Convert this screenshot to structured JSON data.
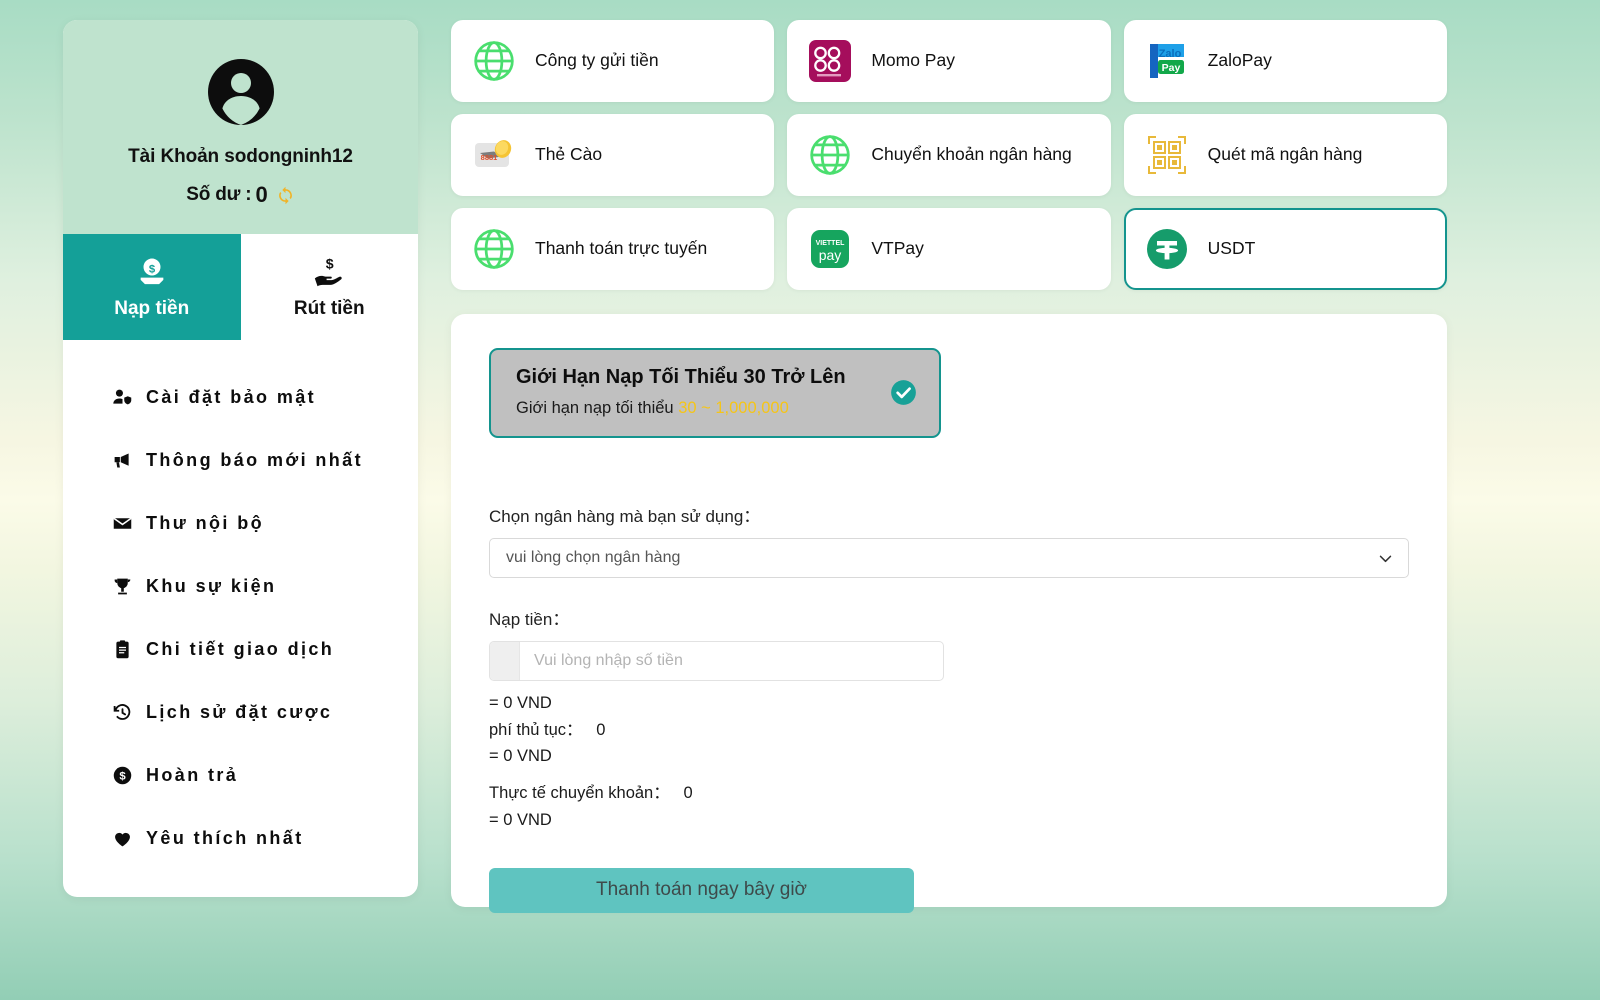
{
  "profile": {
    "avatar_icon": "user-circle-icon",
    "name": "Tài Khoản sodongninh12",
    "balance_label": "Số dư :",
    "balance_value": "0",
    "refresh_icon": "refresh-icon"
  },
  "tabs": [
    {
      "label": "Nạp tiền",
      "icon": "deposit-coin-icon",
      "active": true
    },
    {
      "label": "Rút tiền",
      "icon": "withdraw-hand-icon",
      "active": false
    }
  ],
  "menu": [
    {
      "label": "Cài đặt bảo mật",
      "icon": "user-shield-icon"
    },
    {
      "label": "Thông báo mới nhất",
      "icon": "megaphone-icon"
    },
    {
      "label": "Thư nội bộ",
      "icon": "envelope-icon"
    },
    {
      "label": "Khu sự kiện",
      "icon": "trophy-icon"
    },
    {
      "label": "Chi tiết giao dịch",
      "icon": "clipboard-icon"
    },
    {
      "label": "Lịch sử đặt cược",
      "icon": "history-clock-icon"
    },
    {
      "label": "Hoàn trả",
      "icon": "dollar-circle-icon"
    },
    {
      "label": "Yêu thích nhất",
      "icon": "heart-icon"
    }
  ],
  "methods": [
    {
      "label": "Công ty gửi tiền",
      "icon": "globe-icon",
      "selected": false
    },
    {
      "label": "Momo Pay",
      "icon": "momo-logo-icon",
      "selected": false
    },
    {
      "label": "ZaloPay",
      "icon": "zalopay-logo-icon",
      "selected": false
    },
    {
      "label": "Thẻ Cào",
      "icon": "scratch-card-icon",
      "selected": false
    },
    {
      "label": "Chuyển khoản ngân hàng",
      "icon": "globe-icon",
      "selected": false
    },
    {
      "label": "Quét mã ngân hàng",
      "icon": "qr-code-icon",
      "selected": false
    },
    {
      "label": "Thanh toán trực tuyến",
      "icon": "globe-icon",
      "selected": false
    },
    {
      "label": "VTPay",
      "icon": "viettelpay-logo-icon",
      "selected": false
    },
    {
      "label": "USDT",
      "icon": "tether-usdt-icon",
      "selected": true
    }
  ],
  "notice": {
    "title": "Giới Hạn Nạp Tối Thiểu 30 Trở Lên",
    "sub_prefix": "Giới hạn nạp tối thiểu ",
    "min": "30",
    "separator": " ~ ",
    "max": "1,000,000",
    "check_icon": "check-circle-icon"
  },
  "form": {
    "bank_label": "Chọn ngân hàng mà bạn sử dụng：",
    "bank_selected": "vui lòng chọn ngân hàng",
    "bank_chevron_icon": "chevron-down-icon",
    "amount_label": "Nạp tiền：",
    "amount_value": "",
    "amount_placeholder": "Vui lòng nhập số tiền",
    "line_amount_vnd": "= 0 VND",
    "line_fee": "phí thủ tục：   0",
    "line_fee_vnd": "= 0 VND",
    "line_actual": "Thực tế chuyển khoản：   0",
    "line_actual_vnd": "= 0 VND",
    "submit_label": "Thanh toán ngay bây giờ"
  },
  "colors": {
    "teal": "#14a098",
    "teal_border": "#14948e",
    "button": "#5fc4c0",
    "profile_bg": "#bfe3ce",
    "highlight_yellow": "#f5c518",
    "notice_bg": "#c0c0c0"
  }
}
